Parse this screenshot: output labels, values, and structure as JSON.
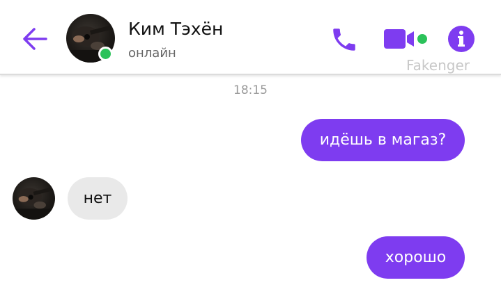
{
  "theme": {
    "accent": "#7e3cf0",
    "online": "#2bc25a",
    "incoming_bubble": "#e9e9e9"
  },
  "header": {
    "back_icon": "arrow-left-icon",
    "contact_name": "Ким Тэхён",
    "contact_status": "онлайн",
    "call_icon": "phone-icon",
    "video_icon": "video-camera-icon",
    "info_icon": "info-icon",
    "watermark": "Fakenger"
  },
  "chat": {
    "timestamp": "18:15",
    "messages": [
      {
        "direction": "outgoing",
        "text": "идёшь в магаз?"
      },
      {
        "direction": "incoming",
        "text": "нет"
      },
      {
        "direction": "outgoing",
        "text": "хорошо"
      }
    ]
  }
}
